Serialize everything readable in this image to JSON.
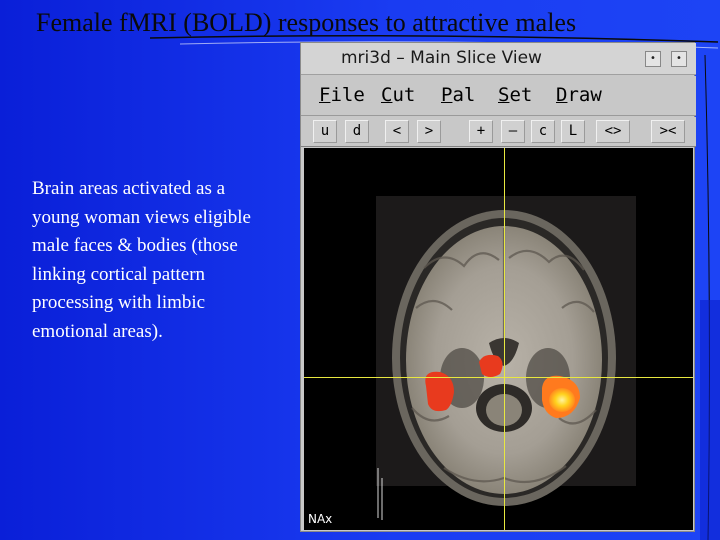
{
  "slide": {
    "title": "Female fMRI (BOLD) responses to attractive males",
    "body": "Brain areas activated as a young woman views eligible male faces & bodies (those linking cortical pattern processing with limbic emotional areas)."
  },
  "window": {
    "title": "mri3d – Main Slice View",
    "controls": [
      "•",
      "•"
    ],
    "menu": [
      "File",
      "Cut",
      "Pal",
      "Set",
      "Draw"
    ],
    "toolbar": [
      "u",
      "d",
      "<",
      ">",
      "+",
      "–",
      "c",
      "L",
      "<>",
      "><"
    ],
    "view_label": "NAx"
  },
  "colors": {
    "background": "#1a3cf2",
    "title_text": "#0a0a0a",
    "body_text": "#ffffff",
    "crosshair": "#e8e840",
    "activation_red": "#e83a1e",
    "activation_yellow": "#ffd21e"
  },
  "icons": {
    "window_controls": [
      "minimize-icon",
      "close-icon"
    ]
  }
}
